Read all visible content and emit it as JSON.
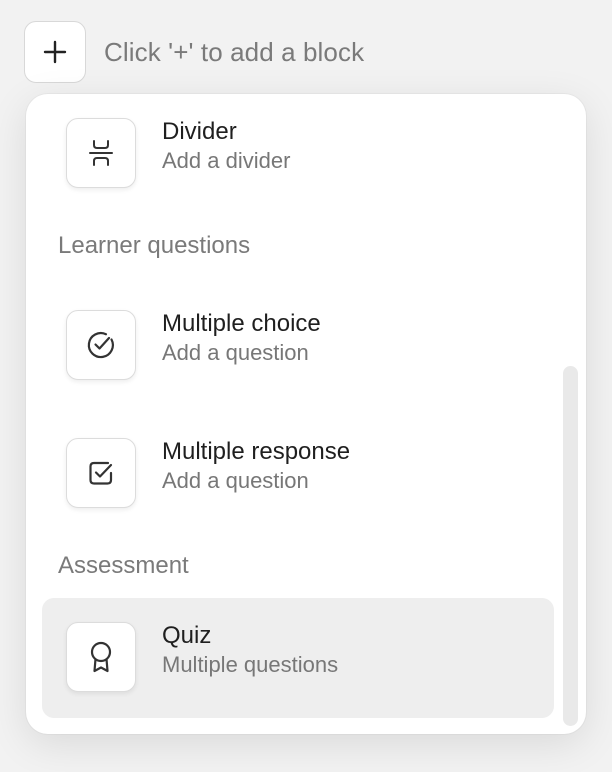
{
  "add_block": {
    "button_icon": "plus-icon",
    "hint": "Click '+' to add a block"
  },
  "menu": {
    "items_top": [
      {
        "icon": "divider-icon",
        "title": "Divider",
        "subtitle": "Add a divider"
      }
    ],
    "sections": [
      {
        "label": "Learner questions",
        "items": [
          {
            "icon": "check-circle-icon",
            "title": "Multiple choice",
            "subtitle": "Add a question"
          },
          {
            "icon": "checkbox-icon",
            "title": "Multiple response",
            "subtitle": "Add a question"
          }
        ]
      },
      {
        "label": "Assessment",
        "items": [
          {
            "icon": "award-icon",
            "title": "Quiz",
            "subtitle": "Multiple questions",
            "selected": true
          }
        ]
      }
    ]
  },
  "colors": {
    "background": "#f2f2f2",
    "menu_background": "#ffffff",
    "selected_background": "#eeeeee",
    "title_text": "#1f1f1f",
    "secondary_text": "#777777",
    "icon_stroke": "#333333"
  }
}
